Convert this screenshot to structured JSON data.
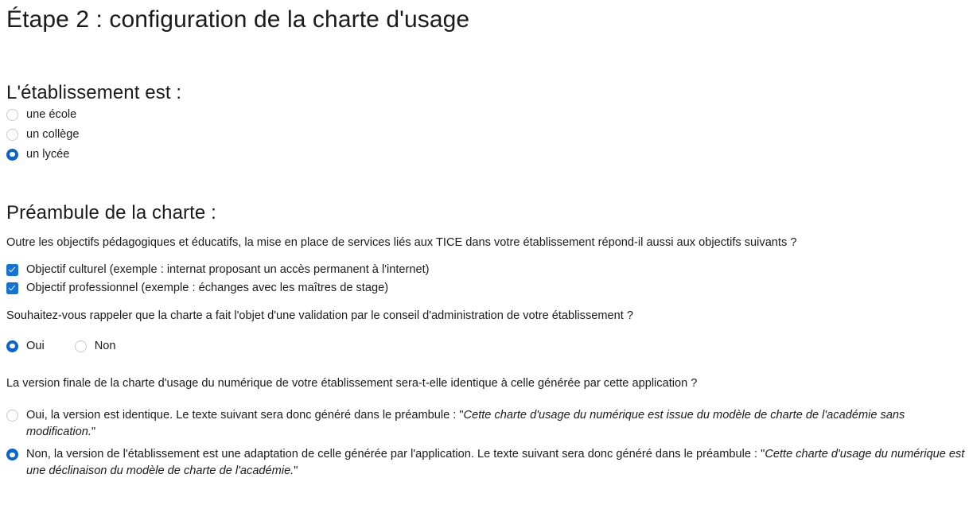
{
  "page": {
    "title": "Étape 2 : configuration de la charte d'usage",
    "accent_color": "#0b63ce",
    "checkbox_color": "#1673d6",
    "text_color": "#1b1b1b",
    "background_color": "#ffffff"
  },
  "establishment": {
    "heading": "L'établissement est :",
    "options": [
      {
        "label": "une école",
        "selected": false
      },
      {
        "label": "un collège",
        "selected": false
      },
      {
        "label": "un lycée",
        "selected": true
      }
    ]
  },
  "preamble": {
    "heading": "Préambule de la charte :",
    "intro": "Outre les objectifs pédagogiques et éducatifs, la mise en place de services liés aux TICE dans votre établissement répond-il aussi aux objectifs suivants ?",
    "objectives": [
      {
        "label": "Objectif culturel (exemple : internat proposant un accès permanent à l'internet)",
        "checked": true
      },
      {
        "label": "Objectif professionnel (exemple : échanges avec les maîtres de stage)",
        "checked": true
      }
    ],
    "validation_question": "Souhaitez-vous rappeler que la charte a fait l'objet d'une validation par le conseil d'administration de votre établissement ?",
    "validation_options": [
      {
        "label": "Oui",
        "selected": true
      },
      {
        "label": "Non",
        "selected": false
      }
    ],
    "final_question": "La version finale de la charte d'usage du numérique de votre établissement sera-t-elle identique à celle générée par cette application ?",
    "final_options": [
      {
        "lead": "Oui, la version est identique. Le texte suivant sera donc généré dans le préambule : ",
        "quote": "Cette charte d'usage du numérique est issue du modèle de charte de l'académie sans modification.",
        "selected": false
      },
      {
        "lead": "Non, la version de l'établissement est une adaptation de celle générée par l'application. Le texte suivant sera donc généré dans le préambule : ",
        "quote": "Cette charte d'usage du numérique est une déclinaison du modèle de charte de l'académie.",
        "selected": true
      }
    ]
  }
}
